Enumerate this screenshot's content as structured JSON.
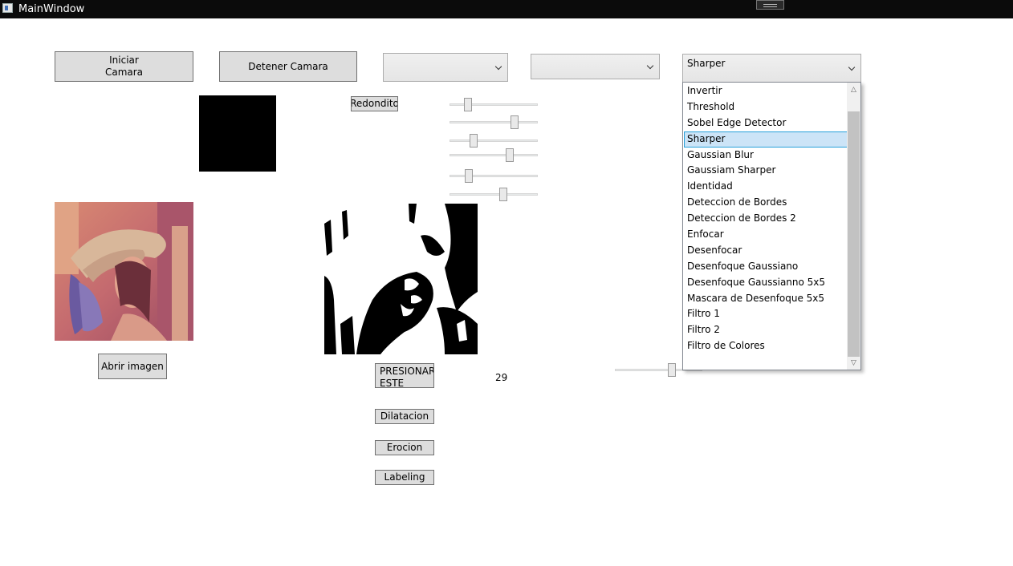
{
  "window": {
    "title": "MainWindow"
  },
  "buttons": {
    "iniciar_camara": "Iniciar\nCamara",
    "detener_camara": "Detener Camara",
    "redondito": "Redondito",
    "abrir_imagen": "Abrir imagen",
    "presionar_este": "PRESIONAR\nESTE",
    "dilatacion": "Dilatacion",
    "erocion": "Erocion",
    "labeling": "Labeling"
  },
  "combos": {
    "combo1_value": "",
    "combo2_value": "",
    "filter_value": "Sharper"
  },
  "label_value": "29",
  "sliders": [
    {
      "name": "slider-1",
      "value": 0.21
    },
    {
      "name": "slider-2",
      "value": 0.74
    },
    {
      "name": "slider-3",
      "value": 0.27
    },
    {
      "name": "slider-4",
      "value": 0.68
    },
    {
      "name": "slider-5",
      "value": 0.22
    },
    {
      "name": "slider-6",
      "value": 0.61
    },
    {
      "name": "slider-7",
      "value": 0.65
    }
  ],
  "filter_options": [
    "Invertir",
    "Threshold",
    "Sobel Edge Detector",
    "Sharper",
    "Gaussian Blur",
    "Gaussiam Sharper",
    "Identidad",
    "Deteccion de Bordes",
    "Deteccion de Bordes 2",
    "Enfocar",
    "Desenfocar",
    "Desenfoque Gaussiano",
    "Desenfoque Gaussianno 5x5",
    "Mascara de Desenfoque 5x5",
    "Filtro 1",
    "Filtro 2",
    "Filtro de Colores"
  ],
  "selected_filter_index": 3,
  "colors": {
    "titlebar": "#0b0b0b",
    "selection": "#cce4f7",
    "selection_border": "#26a0da"
  },
  "icons": {
    "app": "window-app-icon",
    "maximize": "maximize-icon",
    "dropdown": "chevron-down-icon"
  }
}
